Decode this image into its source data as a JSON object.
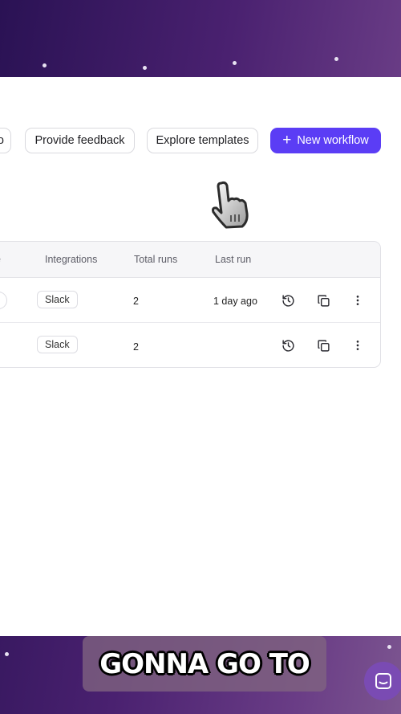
{
  "toolbar": {
    "partial_button_label": "o",
    "feedback_label": "Provide feedback",
    "templates_label": "Explore templates",
    "new_workflow_label": "New workflow",
    "new_workflow_icon": "plus-icon"
  },
  "table": {
    "columns": [
      "pe",
      "Integrations",
      "Total runs",
      "Last run"
    ],
    "rows": [
      {
        "integration": "Slack",
        "total_runs": "2",
        "last_run": "1 day ago"
      },
      {
        "integration": "Slack",
        "total_runs": "2",
        "last_run": ""
      }
    ],
    "row_actions": [
      "history-icon",
      "copy-icon",
      "more-vertical-icon"
    ]
  },
  "caption": {
    "text": "GONNA GO TO"
  },
  "colors": {
    "accent": "#5b3df5",
    "chat_button": "#7a4bb3",
    "background_purple": "#4a2170"
  }
}
